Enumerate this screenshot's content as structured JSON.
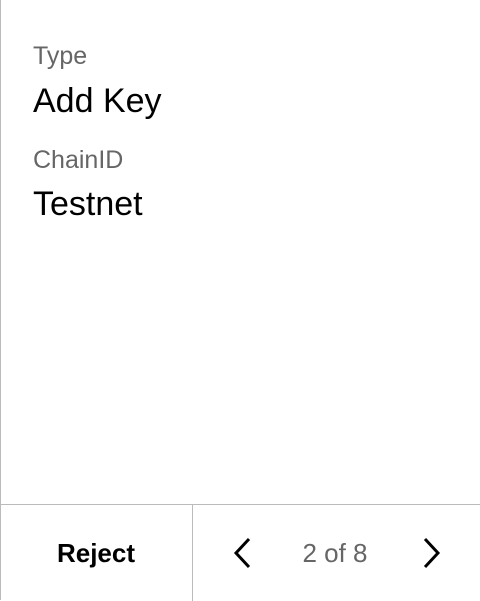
{
  "fields": [
    {
      "label": "Type",
      "value": "Add Key"
    },
    {
      "label": "ChainID",
      "value": "Testnet"
    }
  ],
  "footer": {
    "reject_label": "Reject",
    "page_indicator": "2 of 8",
    "prev_icon": "chevron-left-icon",
    "next_icon": "chevron-right-icon"
  }
}
